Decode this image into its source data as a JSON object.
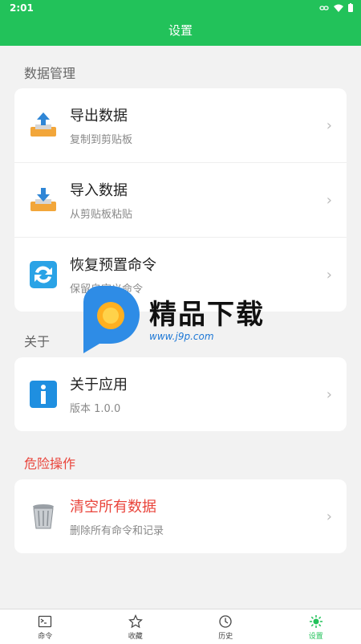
{
  "status": {
    "time": "2:01"
  },
  "appbar": {
    "title": "设置"
  },
  "sections": {
    "data": "数据管理",
    "about": "关于",
    "danger": "危险操作"
  },
  "items": {
    "export": {
      "title": "导出数据",
      "subtitle": "复制到剪贴板"
    },
    "import": {
      "title": "导入数据",
      "subtitle": "从剪贴板粘贴"
    },
    "restore": {
      "title": "恢复预置命令",
      "subtitle": "保留自定义命令"
    },
    "about_app": {
      "title": "关于应用",
      "subtitle": "版本 1.0.0"
    },
    "clear": {
      "title": "清空所有数据",
      "subtitle": "删除所有命令和记录"
    }
  },
  "nav": [
    {
      "label": "命令",
      "icon": "terminal-icon"
    },
    {
      "label": "收藏",
      "icon": "star-icon"
    },
    {
      "label": "历史",
      "icon": "history-icon"
    },
    {
      "label": "设置",
      "icon": "settings-icon",
      "active": true
    }
  ],
  "watermark": {
    "text": "精品下载",
    "url": "www.j9p.com"
  },
  "colors": {
    "accent": "#22c25a",
    "danger": "#e9443b"
  }
}
